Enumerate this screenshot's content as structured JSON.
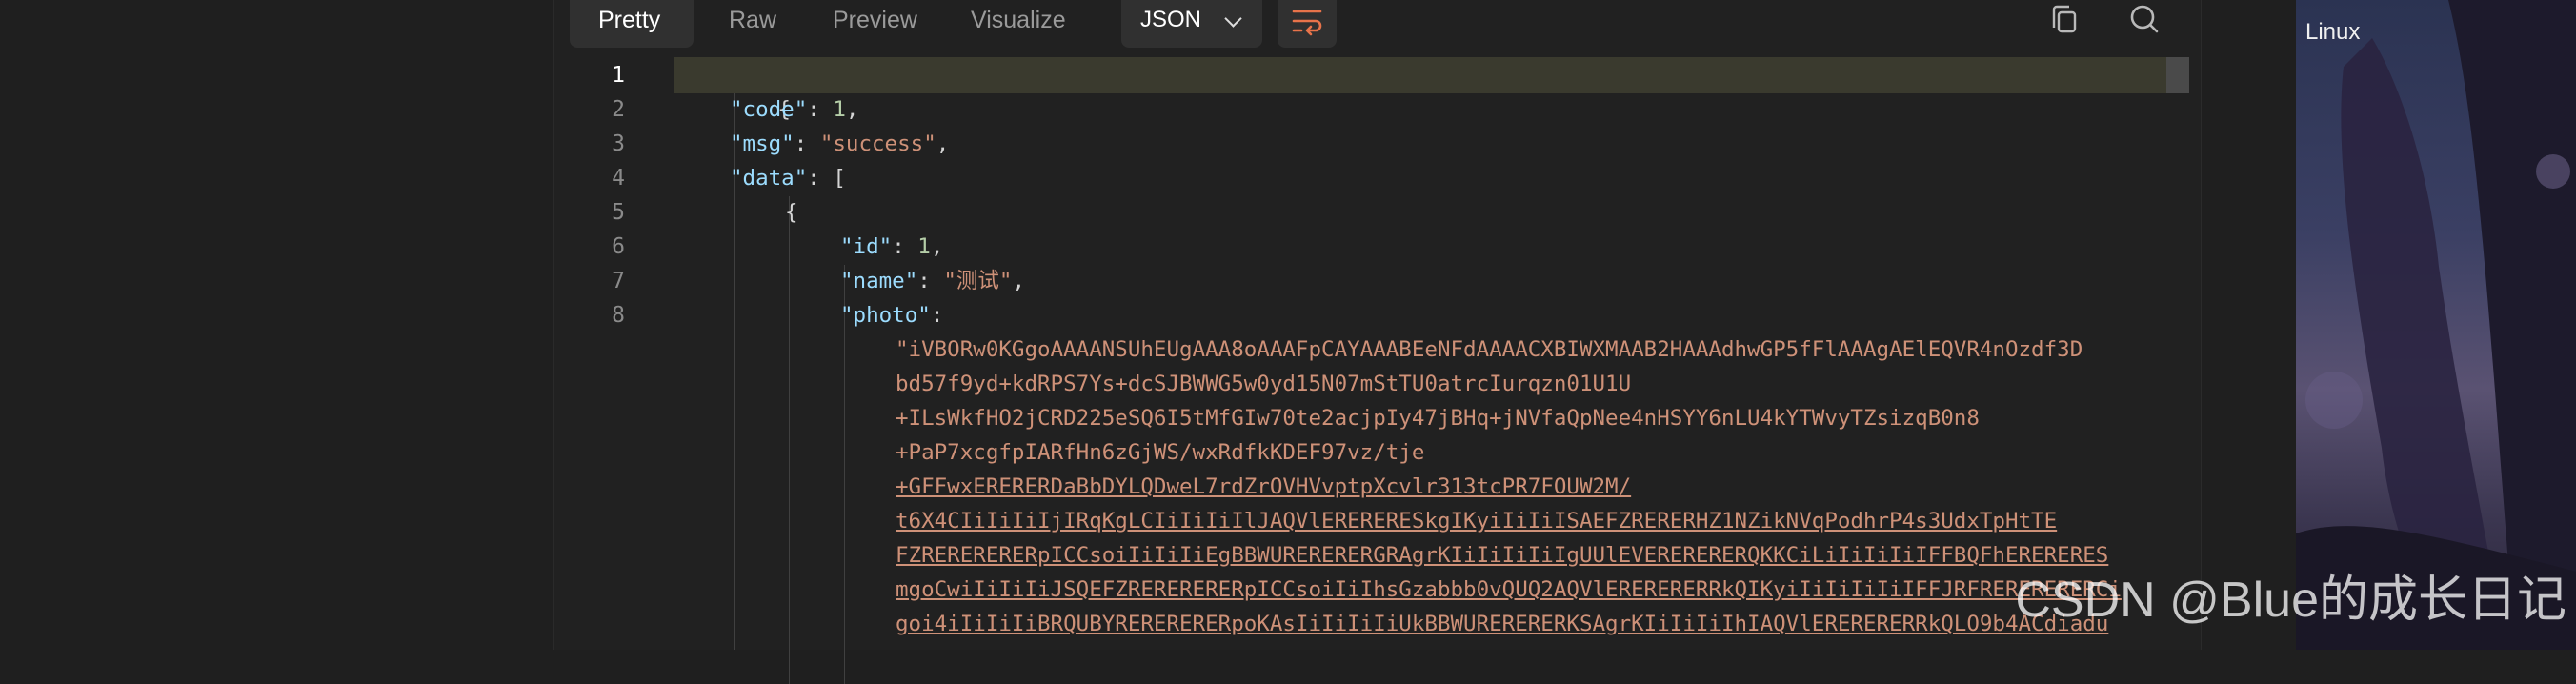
{
  "tabs": [
    {
      "label": "Pretty",
      "active": true
    },
    {
      "label": "Raw",
      "active": false
    },
    {
      "label": "Preview",
      "active": false
    },
    {
      "label": "Visualize",
      "active": false
    }
  ],
  "format_select": {
    "value": "JSON"
  },
  "toolbar_icons": [
    "wrap-lines-icon",
    "copy-icon",
    "search-icon"
  ],
  "line_numbers": [
    "1",
    "2",
    "3",
    "4",
    "5",
    "6",
    "7",
    "8"
  ],
  "json": {
    "open_brace": "{",
    "code_key": "\"code\"",
    "code_value": "1",
    "msg_key": "\"msg\"",
    "msg_value": "\"success\"",
    "data_key": "\"data\"",
    "data_open": "[",
    "item_open": "{",
    "id_key": "\"id\"",
    "id_value": "1",
    "name_key": "\"name\"",
    "name_value": "\"测试\"",
    "photo_key": "\"photo\"",
    "photo_lines": [
      "\"iVBORw0KGgoAAAANSUhEUgAAA8oAAAFpCAYAAABEeNFdAAAACXBIWXMAAB2HAAAdhwGP5fFlAAAgAElEQVR4nOzdf3D",
      "bd57f9yd+kdRPS7Ys+dcSJBWWG5w0yd15N07mStTU0atrcIurqzn01U1U",
      "+ILsWkfHO2jCRD225eSQ6I5tMfGIw70te2acjpIy47jBHq+jNVfaQpNee4nHSYY6nLU4kYTWvyTZsizqB0n8",
      "+PaP7xcgfpIARfHn6zGjWS/wxRdfkKDEF97vz/tje",
      "+GFFwxERERERDaBbDYLQDweL7rdZrOVHVvptpXcvlr313tcPR7FOUW2M/",
      "t6X4CIiIiIiIjIRqKgLCIiIiIiIlJAQVlERERERESkgIKyiIiIiISAEFZRERERHZ1NZikNVqPodhrP4s3UdxTpHtTE",
      "FZRERERERERpICCsoiIiIiIiEgBBWURERERERGRAgrKIiIiIiIiIgUUlEVERERERERQKKCiLiIiIiIiIFFBQFhERERERES",
      "mgoCwiIiIiIiJSQEFZRERERERERpICCsoiIiIhsGzabbb0vQUQ2AQVlERERERERRkQIKyiIiIiIiIiIFFJRFRERERERERCi",
      "goi4iIiIiIiBRQUBYRERERERERpoKAsIiIiIiIiUkBBWURERERERKSAgrKIiIiIiIhIAQVlERERERERRkQLO9b4ACdiadu"
    ]
  },
  "watermark": "CSDN @Blue的成长日记",
  "side_label": "Linux"
}
